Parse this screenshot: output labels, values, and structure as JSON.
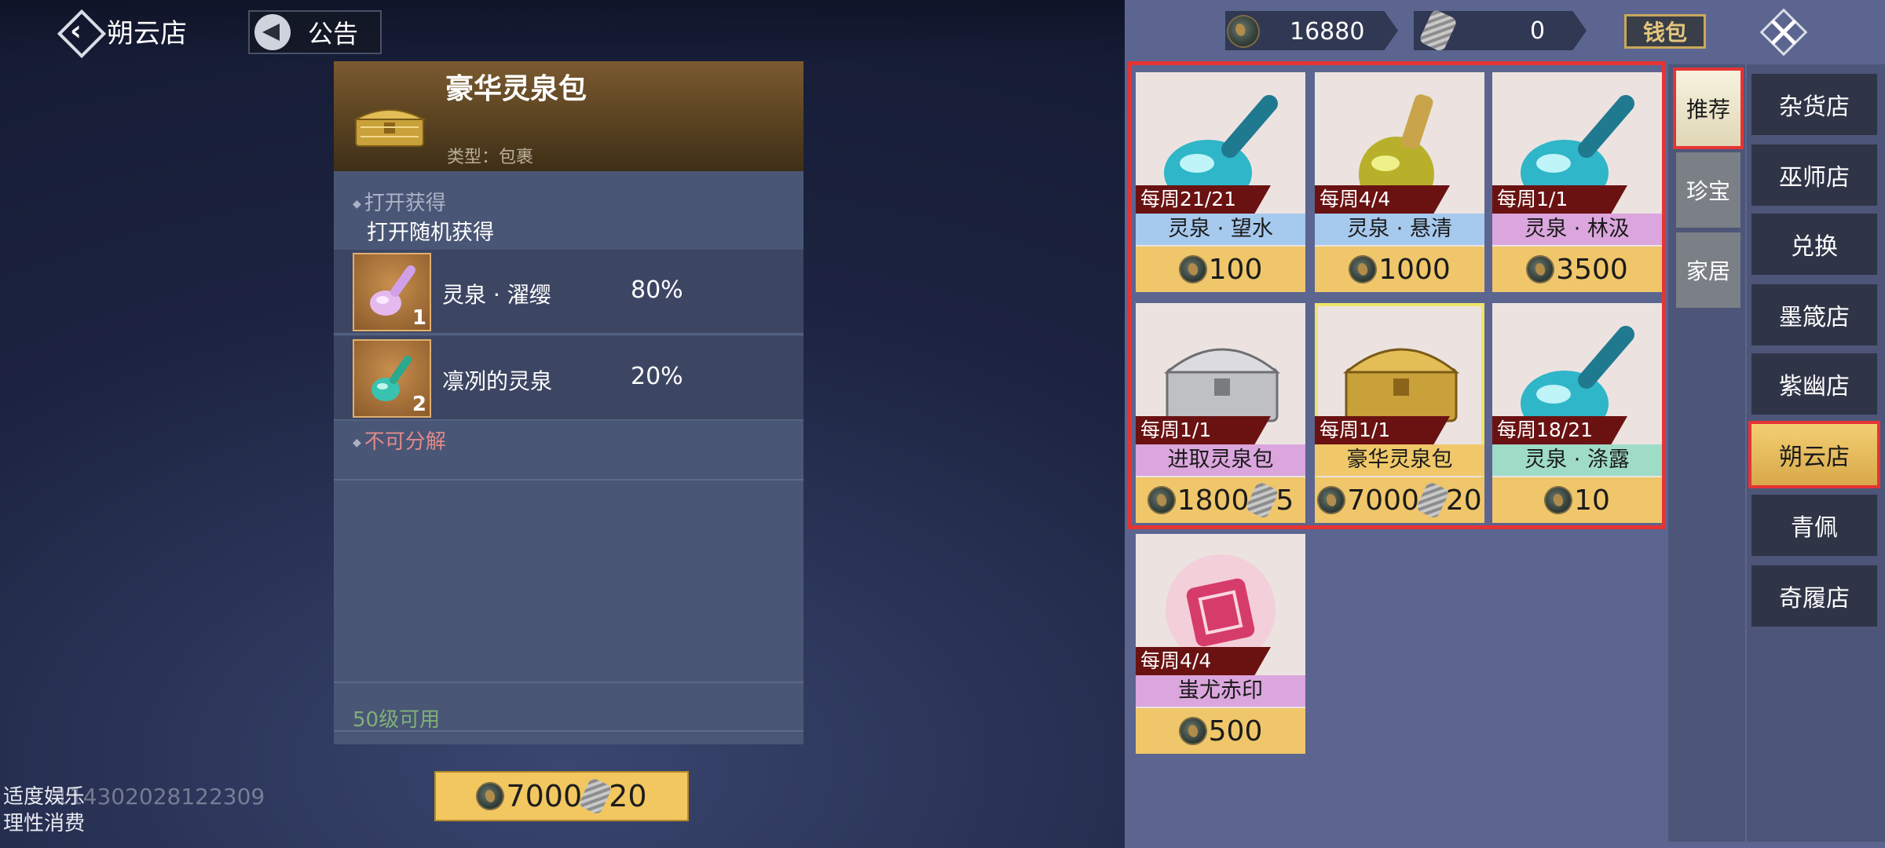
{
  "header": {
    "back_label": "朔云店",
    "notice_label": "公告"
  },
  "detail": {
    "name": "豪华灵泉包",
    "type": "类型：包裹",
    "open_label": "打开获得",
    "open_desc": "打开随机获得",
    "drops": [
      {
        "name": "灵泉 · 濯缨",
        "count": "1",
        "percent": "80%"
      },
      {
        "name": "凛冽的灵泉",
        "count": "2",
        "percent": "20%"
      }
    ],
    "no_decompose": "不可分解",
    "level_req": "50级可用",
    "buy_price": "7000",
    "buy_price2": "20"
  },
  "notice_left": {
    "line1": "适度娱乐",
    "line2": "理性消费"
  },
  "watermark": "114302028122309",
  "currency": {
    "coin": "16880",
    "ingot": "0",
    "wallet_label": "钱包"
  },
  "items": [
    {
      "limit": "每周21/21",
      "name": "灵泉 · 望水",
      "price": "100",
      "price2": "",
      "name_color": "#a6c9ee"
    },
    {
      "limit": "每周4/4",
      "name": "灵泉 · 悬清",
      "price": "1000",
      "price2": "",
      "name_color": "#a6c9ee"
    },
    {
      "limit": "每周1/1",
      "name": "灵泉 · 林汲",
      "price": "3500",
      "price2": "",
      "name_color": "#dba6dd"
    },
    {
      "limit": "每周1/1",
      "name": "进取灵泉包",
      "price": "1800",
      "price2": "5",
      "name_color": "#dba6dd"
    },
    {
      "limit": "每周1/1",
      "name": "豪华灵泉包",
      "price": "7000",
      "price2": "20",
      "name_color": "#f0c86a"
    },
    {
      "limit": "每周18/21",
      "name": "灵泉 · 涤露",
      "price": "10",
      "price2": "",
      "name_color": "#9fdcc8"
    },
    {
      "limit": "每周4/4",
      "name": "蚩尤赤印",
      "price": "500",
      "price2": "",
      "name_color": "#dba6dd"
    }
  ],
  "tabs": [
    "推荐",
    "珍宝",
    "家居"
  ],
  "shops": [
    "杂货店",
    "巫师店",
    "兑换",
    "墨箴店",
    "紫幽店",
    "朔云店",
    "青佩",
    "奇履店"
  ],
  "colors": {
    "accent_red": "#e53434",
    "gold": "#f2c760",
    "panel": "#4a5675"
  }
}
